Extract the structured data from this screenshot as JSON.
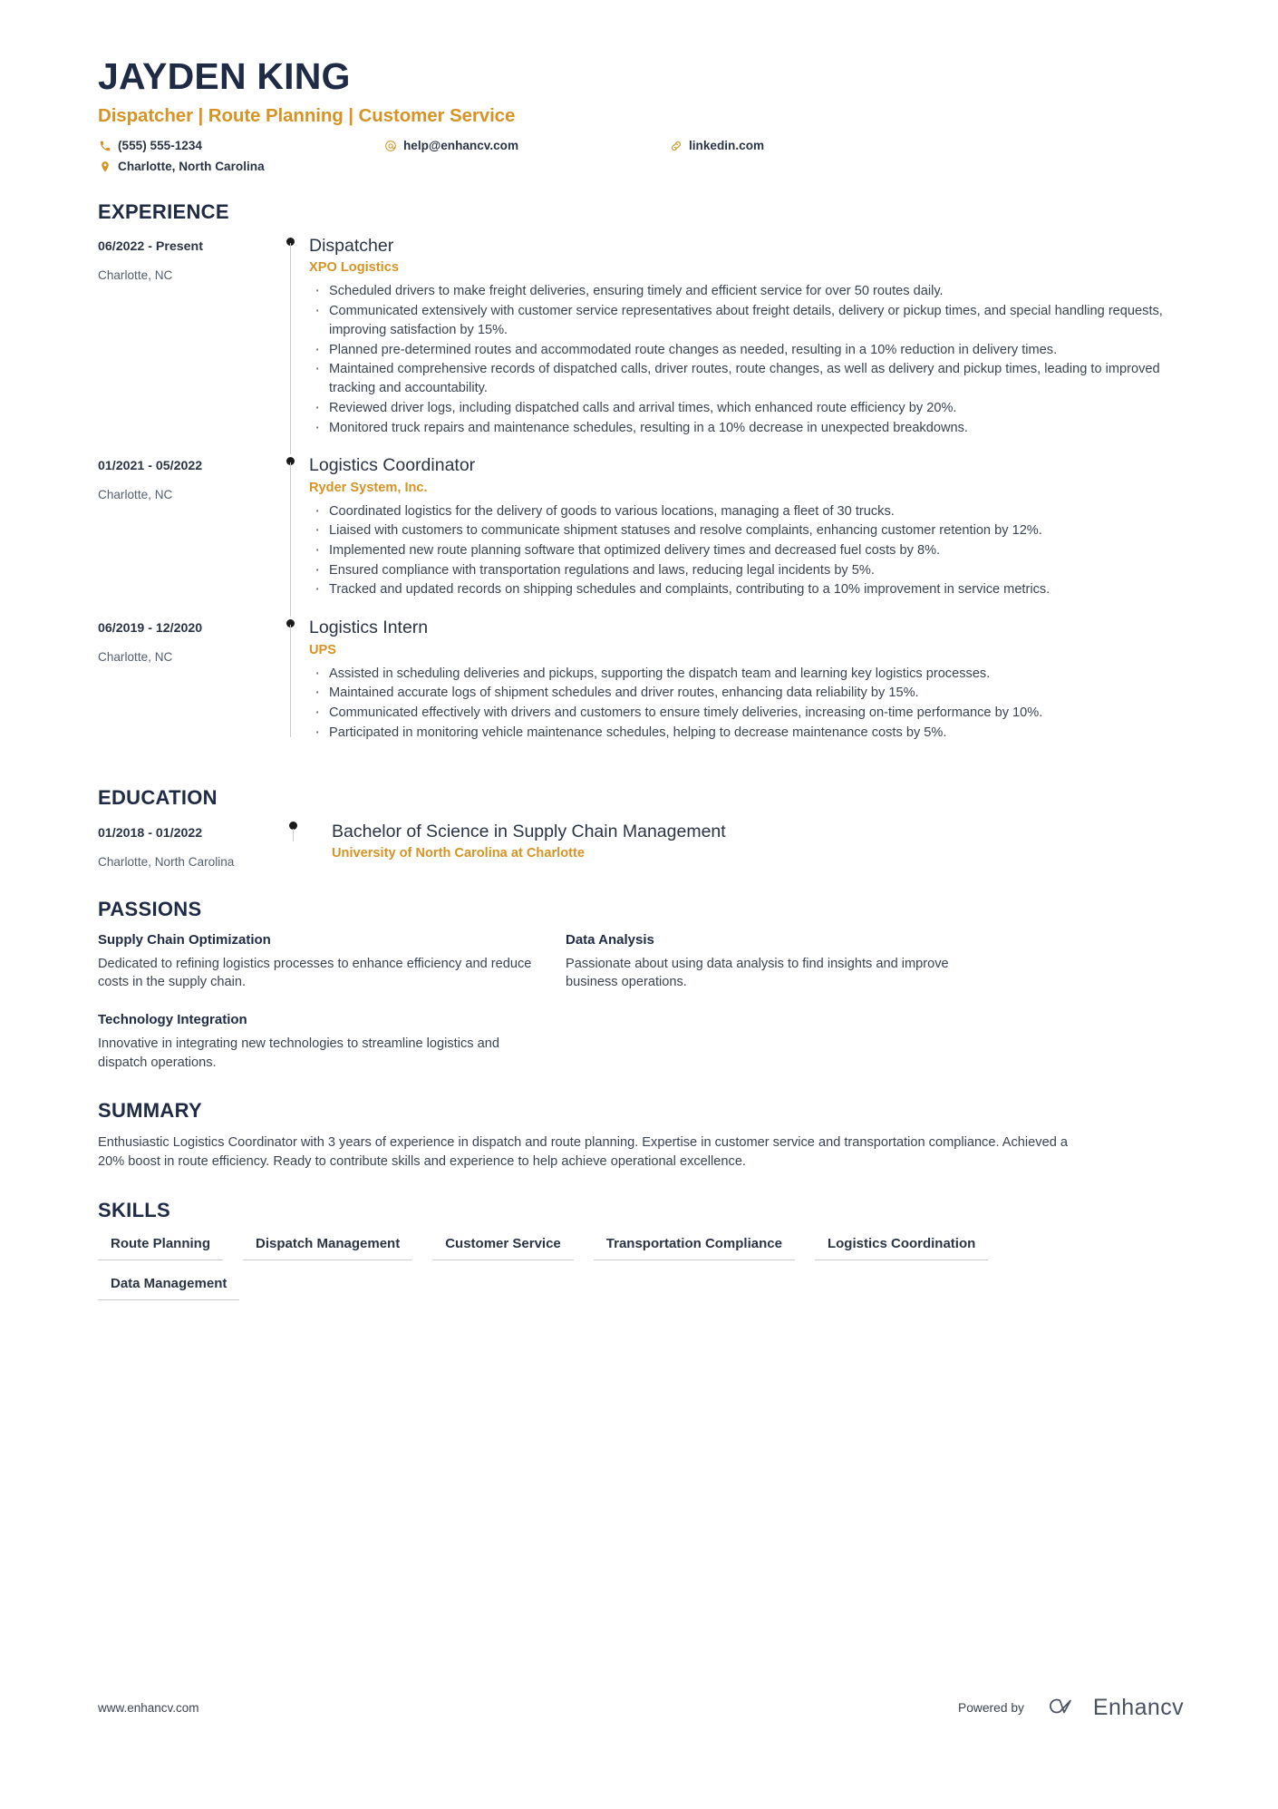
{
  "header": {
    "name": "JAYDEN KING",
    "headline": "Dispatcher | Route Planning | Customer Service",
    "contacts": [
      {
        "icon": "phone-icon",
        "value": "(555) 555-1234"
      },
      {
        "icon": "email-icon",
        "value": "help@enhancv.com"
      },
      {
        "icon": "link-icon",
        "value": "linkedin.com"
      },
      {
        "icon": "location-icon",
        "value": "Charlotte, North Carolina"
      }
    ]
  },
  "colors": {
    "accent": "#d59425",
    "heading": "#1f2a44",
    "body": "#3b4452",
    "rule": "#c9ccd1"
  },
  "experience": {
    "title": "EXPERIENCE",
    "entries": [
      {
        "date": "06/2022 - Present",
        "location": "Charlotte, NC",
        "job_title": "Dispatcher",
        "company": "XPO Logistics",
        "bullets": [
          "Scheduled drivers to make freight deliveries, ensuring timely and efficient service for over 50 routes daily.",
          "Communicated extensively with customer service representatives about freight details, delivery or pickup times, and special handling requests, improving satisfaction by 15%.",
          "Planned pre-determined routes and accommodated route changes as needed, resulting in a 10% reduction in delivery times.",
          "Maintained comprehensive records of dispatched calls, driver routes, route changes, as well as delivery and pickup times, leading to improved tracking and accountability.",
          "Reviewed driver logs, including dispatched calls and arrival times, which enhanced route efficiency by 20%.",
          "Monitored truck repairs and maintenance schedules, resulting in a 10% decrease in unexpected breakdowns."
        ]
      },
      {
        "date": "01/2021 - 05/2022",
        "location": "Charlotte, NC",
        "job_title": "Logistics Coordinator",
        "company": "Ryder System, Inc.",
        "bullets": [
          "Coordinated logistics for the delivery of goods to various locations, managing a fleet of 30 trucks.",
          "Liaised with customers to communicate shipment statuses and resolve complaints, enhancing customer retention by 12%.",
          "Implemented new route planning software that optimized delivery times and decreased fuel costs by 8%.",
          "Ensured compliance with transportation regulations and laws, reducing legal incidents by 5%.",
          "Tracked and updated records on shipping schedules and complaints, contributing to a 10% improvement in service metrics."
        ]
      },
      {
        "date": "06/2019 - 12/2020",
        "location": "Charlotte, NC",
        "job_title": "Logistics Intern",
        "company": "UPS",
        "bullets": [
          "Assisted in scheduling deliveries and pickups, supporting the dispatch team and learning key logistics processes.",
          "Maintained accurate logs of shipment schedules and driver routes, enhancing data reliability by 15%.",
          "Communicated effectively with drivers and customers to ensure timely deliveries, increasing on-time performance by 10%.",
          "Participated in monitoring vehicle maintenance schedules, helping to decrease maintenance costs by 5%."
        ]
      }
    ]
  },
  "education": {
    "title": "EDUCATION",
    "entries": [
      {
        "date": "01/2018 - 01/2022",
        "location": "Charlotte, North Carolina",
        "degree": "Bachelor of Science in Supply Chain Management",
        "school": "University of North Carolina at Charlotte"
      }
    ]
  },
  "passions": {
    "title": "PASSIONS",
    "items": [
      {
        "title": "Supply Chain Optimization",
        "description": "Dedicated to refining logistics processes to enhance efficiency and reduce costs in the supply chain."
      },
      {
        "title": "Data Analysis",
        "description": "Passionate about using data analysis to find insights and improve business operations."
      },
      {
        "title": "Technology Integration",
        "description": "Innovative in integrating new technologies to streamline logistics and dispatch operations."
      }
    ]
  },
  "summary": {
    "title": "SUMMARY",
    "text": "Enthusiastic Logistics Coordinator with 3 years of experience in dispatch and route planning. Expertise in customer service and transportation compliance. Achieved a 20% boost in route efficiency. Ready to contribute skills and experience to help achieve operational excellence."
  },
  "skills": {
    "title": "SKILLS",
    "items": [
      "Route Planning",
      "Dispatch Management",
      "Customer Service",
      "Transportation Compliance",
      "Logistics Coordination",
      "Data Management"
    ]
  },
  "footer": {
    "url": "www.enhancv.com",
    "powered_by": "Powered by",
    "brand": "Enhancv"
  }
}
